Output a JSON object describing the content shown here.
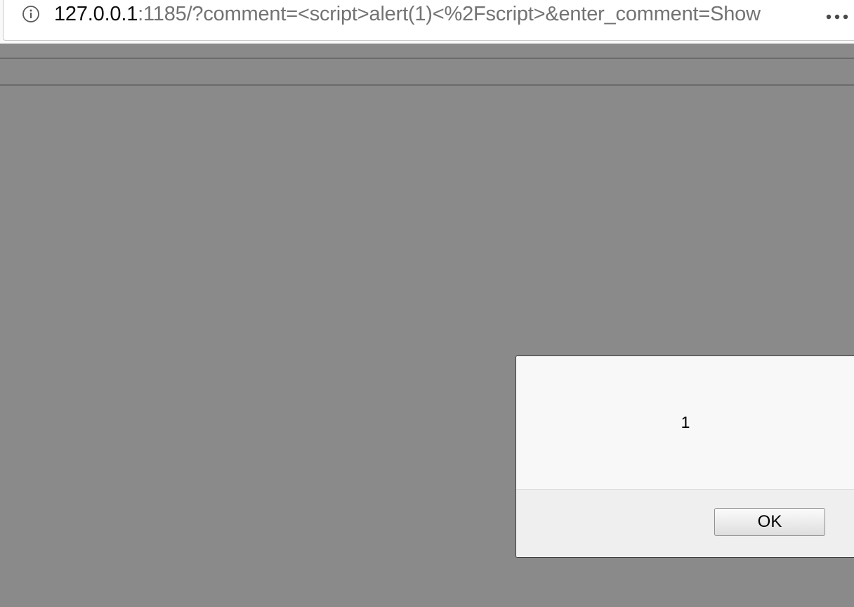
{
  "browser": {
    "url_host": "127.0.0.1",
    "url_rest": ":1185/?comment=<script>alert(1)<%2Fscript>&enter_comment=Show",
    "info_icon": "info-circle-icon",
    "page_actions_icon": "ellipsis-icon"
  },
  "alert": {
    "message": "1",
    "ok_label": "OK"
  },
  "colors": {
    "overlay": "#8a8a8a",
    "url_host": "#0c0c0d",
    "url_rest": "#737373",
    "dialog_bg": "#f8f8f8"
  }
}
